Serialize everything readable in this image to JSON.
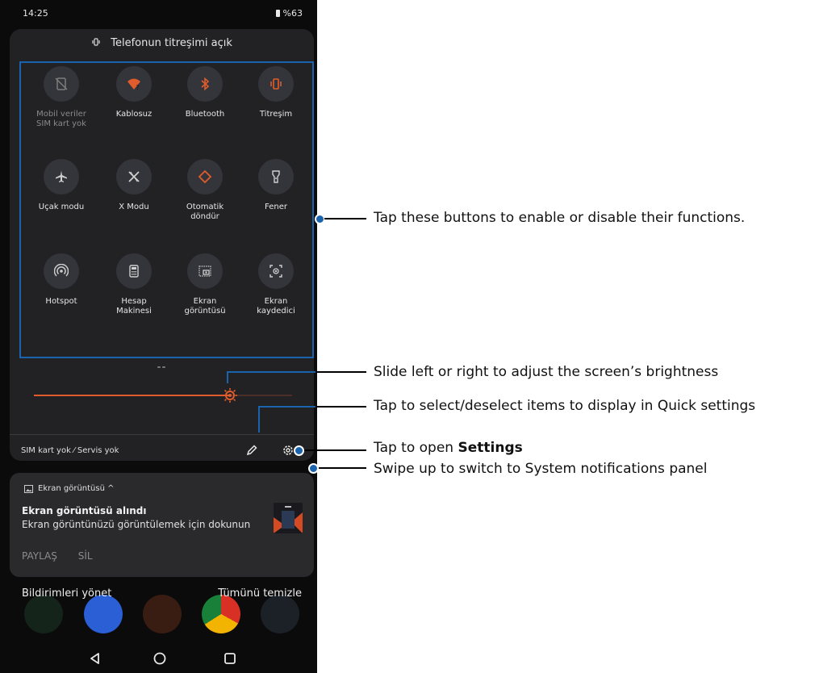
{
  "status_bar": {
    "time": "14:25",
    "battery": "%63"
  },
  "vibration_banner": "Telefonun titreşimi açık",
  "tiles": [
    {
      "label": "Mobil veriler\nSIM kart yok",
      "icon": "no-sim-icon",
      "active": false,
      "dim": true
    },
    {
      "label": "Kablosuz",
      "icon": "wifi-question-icon",
      "active": true
    },
    {
      "label": "Bluetooth",
      "icon": "bluetooth-icon",
      "active": true
    },
    {
      "label": "Titreşim",
      "icon": "vibrate-icon",
      "active": true
    },
    {
      "label": "Uçak modu",
      "icon": "airplane-icon",
      "active": false
    },
    {
      "label": "X Modu",
      "icon": "x-mode-icon",
      "active": false
    },
    {
      "label": "Otomatik\ndöndür",
      "icon": "auto-rotate-icon",
      "active": true
    },
    {
      "label": "Fener",
      "icon": "flashlight-icon",
      "active": false
    },
    {
      "label": "Hotspot",
      "icon": "hotspot-icon",
      "active": false
    },
    {
      "label": "Hesap\nMakinesi",
      "icon": "calculator-icon",
      "active": false
    },
    {
      "label": "Ekran\ngörüntüsü",
      "icon": "screenshot-icon",
      "active": false
    },
    {
      "label": "Ekran\nkaydedici",
      "icon": "screen-recorder-icon",
      "active": false
    }
  ],
  "brightness": {
    "level": 0.76
  },
  "sim_status": "SIM kart yok ⁄ Servis yok",
  "notification": {
    "app": "Ekran görüntüsü ^",
    "title": "Ekran görüntüsü alındı",
    "body": "Ekran görüntünüzü görüntülemek için dokunun",
    "actions": [
      "PAYLAŞ",
      "SİL"
    ]
  },
  "footer": {
    "manage": "Bildirimleri yönet",
    "clear": "Tümünü temizle"
  },
  "annotations": {
    "buttons": "Tap these buttons to enable or disable their functions.",
    "brightness": "Slide left or right to adjust the screen’s brightness",
    "edit": "Tap to select/deselect items to display in Quick settings",
    "settings_prefix": "Tap to open ",
    "settings_bold": "Settings",
    "swipe": "Swipe up to switch to System notifications panel"
  },
  "colors": {
    "accent": "#e05c2c",
    "annotation": "#1a64ad",
    "panel": "#222224"
  }
}
